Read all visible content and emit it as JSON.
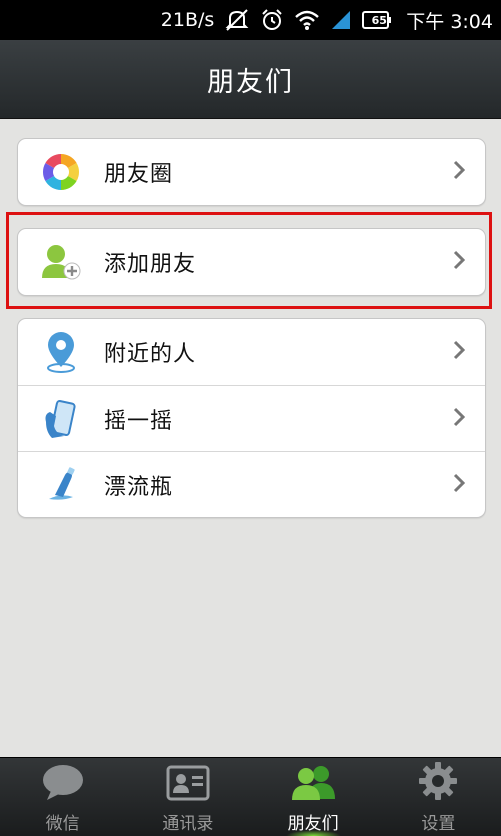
{
  "status_bar": {
    "speed": "21B/s",
    "battery": "65",
    "time": "下午 3:04"
  },
  "title": "朋友们",
  "groups": [
    {
      "items": [
        {
          "label": "朋友圈",
          "icon": "moments-icon"
        }
      ]
    },
    {
      "items": [
        {
          "label": "添加朋友",
          "icon": "add-friend-icon"
        }
      ]
    },
    {
      "items": [
        {
          "label": "附近的人",
          "icon": "location-pin-icon"
        },
        {
          "label": "摇一摇",
          "icon": "shake-phone-icon"
        },
        {
          "label": "漂流瓶",
          "icon": "drift-bottle-icon"
        }
      ]
    }
  ],
  "highlight_color": "#dd1111",
  "tabs": [
    {
      "label": "微信",
      "icon": "chat-bubble-icon",
      "active": false
    },
    {
      "label": "通讯录",
      "icon": "contacts-card-icon",
      "active": false
    },
    {
      "label": "朋友们",
      "icon": "friends-icon",
      "active": true
    },
    {
      "label": "设置",
      "icon": "gear-icon",
      "active": false
    }
  ]
}
